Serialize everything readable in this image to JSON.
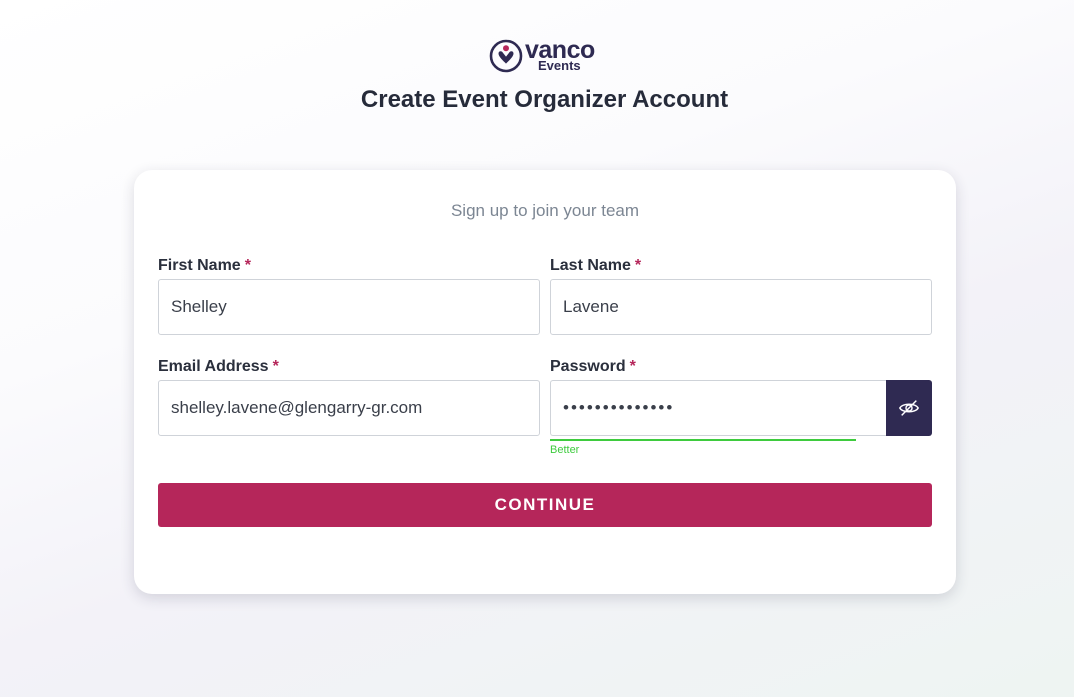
{
  "brand": {
    "name": "vanco",
    "sub": "Events"
  },
  "page_title": "Create Event Organizer Account",
  "subtitle": "Sign up to join your team",
  "required_marker": "*",
  "fields": {
    "first_name": {
      "label": "First Name",
      "value": "Shelley"
    },
    "last_name": {
      "label": "Last Name",
      "value": "Lavene"
    },
    "email": {
      "label": "Email Address",
      "value": "shelley.lavene@glengarry-gr.com"
    },
    "password": {
      "label": "Password",
      "value": "••••••••••••••",
      "strength": "Better"
    }
  },
  "continue_label": "CONTINUE",
  "colors": {
    "brand_navy": "#2f2a52",
    "accent": "#b5265a",
    "strength_good": "#3ecb3e"
  },
  "icons": {
    "logo": "vanco-heart-person-icon",
    "password_toggle": "eye-slash-icon"
  }
}
